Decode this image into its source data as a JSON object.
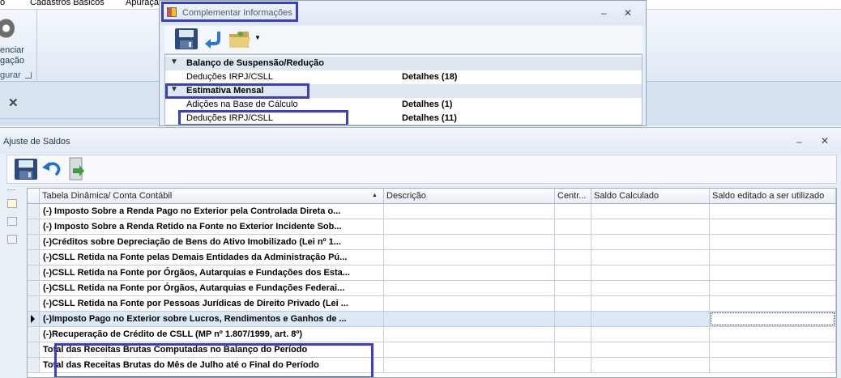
{
  "menubar": {
    "items": [
      "o",
      "Cadastros Básicos",
      "Apuração"
    ]
  },
  "ribbon": {
    "line1": "enciar",
    "line2": "gação",
    "group_label": "gurar"
  },
  "doc_tabs": {
    "close_glyph": "✕"
  },
  "complementar": {
    "title": "Complementar Informações",
    "minimize_glyph": "‒",
    "close_glyph": "✕",
    "groups": [
      {
        "label": "Balanço de Suspensão/Redução",
        "rows": [
          {
            "name": "Deduções IRPJ/CSLL",
            "detail": "Detalhes (18)"
          }
        ]
      },
      {
        "label": "Estimativa Mensal",
        "rows": [
          {
            "name": "Adições na Base de Cálculo",
            "detail": "Detalhes (1)"
          },
          {
            "name": "Deduções IRPJ/CSLL",
            "detail": "Detalhes (11)"
          }
        ]
      }
    ]
  },
  "ajuste": {
    "title": "Ajuste de Saldos",
    "minimize_glyph": "‒",
    "close_glyph": "✕",
    "columns": [
      "Tabela Dinâmica/ Conta Contábil",
      "Descrição",
      "Centr...",
      "Saldo Calculado",
      "Saldo editado a ser utilizado"
    ],
    "sort_glyph": "▲",
    "rows": [
      "(-) Imposto Sobre a Renda Pago no Exterior pela Controlada Direta o...",
      "(-) Imposto Sobre a Renda Retido na Fonte no Exterior Incidente Sob...",
      "(-)Créditos sobre Depreciação de Bens do Ativo Imobilizado (Lei nº 1...",
      "(-)CSLL Retida na Fonte pelas Demais Entidades da Administração Pú...",
      "(-)CSLL Retida na Fonte por Órgãos, Autarquias e Fundações dos Esta...",
      "(-)CSLL Retida na Fonte por Órgãos, Autarquias e Fundações Federai...",
      "(-)CSLL Retida na Fonte por Pessoas Jurídicas de Direito Privado (Lei ...",
      "(-)Imposto Pago no Exterior sobre Lucros, Rendimentos e Ganhos de ...",
      "(-)Recuperação de Crédito de CSLL (MP nº 1.807/1999, art. 8º)",
      "Total das Receitas Brutas Computadas no Balanço do Período",
      "Total das Receitas Brutas do Mês de Julho até o Final do Período"
    ],
    "selected_row": 7
  }
}
